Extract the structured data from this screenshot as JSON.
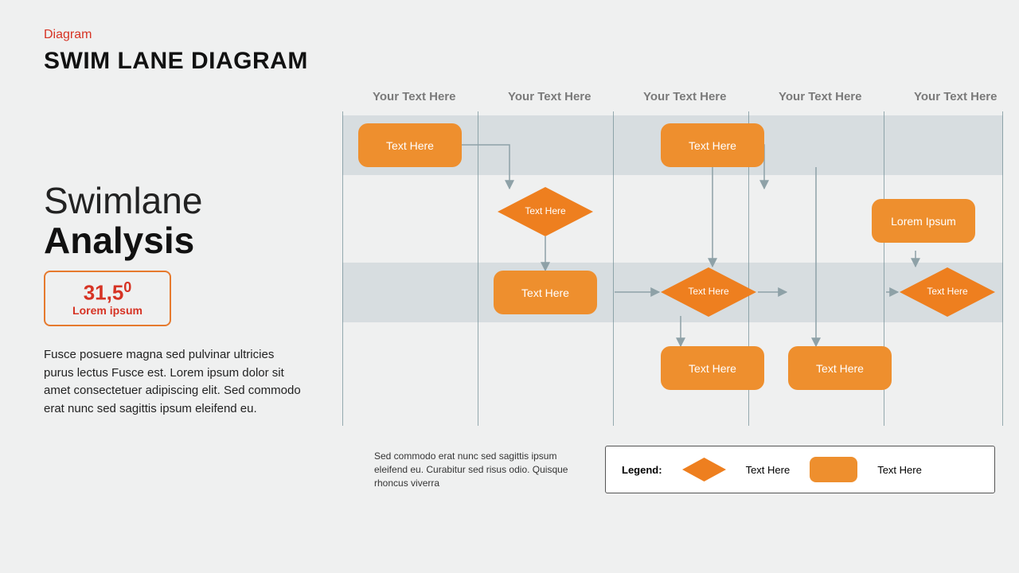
{
  "kicker": "Diagram",
  "page_title": "SWIM LANE DIAGRAM",
  "heading": {
    "line1": "Swimlane",
    "line2": "Analysis"
  },
  "metric": {
    "value": "31,5",
    "sup": "0",
    "caption": "Lorem ipsum"
  },
  "paragraph": "Fusce posuere magna sed pulvinar ultricies purus lectus Fusce est. Lorem ipsum dolor sit amet consectetuer adipiscing elit. Sed commodo erat nunc sed sagittis ipsum eleifend eu.",
  "columns": [
    "Your Text Here",
    "Your Text Here",
    "Your Text Here",
    "Your Text Here",
    "Your Text Here"
  ],
  "shapes": {
    "r1": "Text Here",
    "r2": "Text Here",
    "d1": "Text\nHere",
    "r3": "Text Here",
    "d2": "Text\nHere",
    "r4": "Text Here",
    "r5": "Text Here",
    "r6": "Lorem Ipsum",
    "d3": "Text\nHere"
  },
  "footnote": "Sed commodo  erat nunc sed sagittis ipsum eleifend eu. Curabitur sed risus odio. Quisque rhoncus viverra",
  "legend": {
    "title": "Legend:",
    "diamond": "Text Here",
    "rect": "Text Here"
  },
  "colors": {
    "accent": "#ee8f2e",
    "accent_red": "#d63324",
    "band": "#d7dde0",
    "grid": "#6e8a92"
  }
}
